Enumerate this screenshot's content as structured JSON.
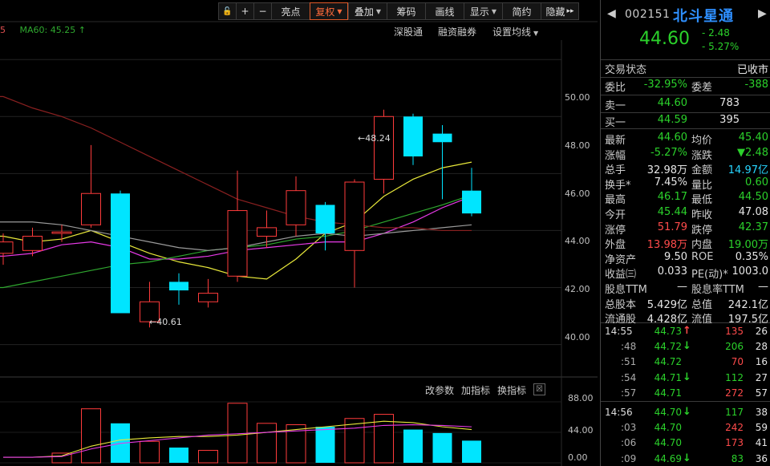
{
  "toolbar": {
    "buttons": [
      {
        "label": "🔓",
        "name": "lock-icon",
        "w": 22
      },
      {
        "label": "+",
        "name": "zoom-in-button",
        "w": 22
      },
      {
        "label": "−",
        "name": "zoom-out-button",
        "w": 22
      },
      {
        "label": "亮点",
        "name": "highlights-button",
        "w": 48
      },
      {
        "label": "复权",
        "name": "adjust-button",
        "w": 48,
        "active": true,
        "caret": true
      },
      {
        "label": "叠加",
        "name": "overlay-button",
        "w": 48,
        "caret": true
      },
      {
        "label": "筹码",
        "name": "chips-button",
        "w": 48
      },
      {
        "label": "画线",
        "name": "draw-line-button",
        "w": 48
      },
      {
        "label": "显示",
        "name": "display-button",
        "w": 48,
        "caret": true
      },
      {
        "label": "简约",
        "name": "simple-button",
        "w": 48
      },
      {
        "label": "隐藏",
        "name": "hide-button",
        "w": 48,
        "more": "▸▸"
      }
    ]
  },
  "chart": {
    "ma_label_partial": "5",
    "ma60_label": "MA60: 45.25 ↑",
    "top_links": [
      "深股通",
      "融资融券",
      "设置均线"
    ],
    "sub_links": [
      "改参数",
      "加指标",
      "换指标"
    ],
    "close_glyph": "☒",
    "high_mark": "48.24",
    "low_mark": "40.61",
    "price_axis": [
      "50.00",
      "48.00",
      "46.00",
      "44.00",
      "42.00",
      "40.00"
    ],
    "volume_axis": [
      "88.00",
      "44.00",
      "0.00"
    ]
  },
  "chart_data": {
    "type": "candlestick",
    "yaxis_ticks": [
      40,
      42,
      44,
      46,
      48,
      50
    ],
    "ylim": [
      39.2,
      50.4
    ],
    "volume_ticks": [
      0,
      44,
      88
    ],
    "volume_ylim": [
      0,
      95
    ],
    "candles": [
      {
        "o": 43.6,
        "c": 43.2,
        "h": 43.9,
        "l": 42.8,
        "up": true,
        "vol": 0
      },
      {
        "o": 43.3,
        "c": 43.8,
        "h": 44.1,
        "l": 43.1,
        "up": true,
        "vol": 0
      },
      {
        "o": 43.9,
        "c": 43.95,
        "h": 44.2,
        "l": 43.6,
        "up": true,
        "vol": 14
      },
      {
        "o": 44.2,
        "c": 45.3,
        "h": 47.0,
        "l": 44.1,
        "up": true,
        "vol": 78
      },
      {
        "o": 45.3,
        "c": 41.1,
        "h": 45.4,
        "l": 41.1,
        "up": false,
        "vol": 57
      },
      {
        "o": 41.5,
        "c": 40.8,
        "h": 42.2,
        "l": 40.6,
        "up": true,
        "vol": 31
      },
      {
        "o": 42.2,
        "c": 41.9,
        "h": 42.5,
        "l": 41.4,
        "up": false,
        "vol": 22
      },
      {
        "o": 41.8,
        "c": 41.5,
        "h": 42.3,
        "l": 41.3,
        "up": true,
        "vol": 18
      },
      {
        "o": 42.4,
        "c": 44.7,
        "h": 46.1,
        "l": 42.2,
        "up": true,
        "vol": 86
      },
      {
        "o": 44.1,
        "c": 43.8,
        "h": 44.7,
        "l": 43.4,
        "up": true,
        "vol": 57
      },
      {
        "o": 44.2,
        "c": 45.4,
        "h": 45.9,
        "l": 43.8,
        "up": true,
        "vol": 55
      },
      {
        "o": 44.9,
        "c": 43.9,
        "h": 45.0,
        "l": 43.3,
        "up": false,
        "vol": 52
      },
      {
        "o": 43.3,
        "c": 45.7,
        "h": 45.8,
        "l": 42.0,
        "up": true,
        "vol": 64
      },
      {
        "o": 45.8,
        "c": 48.0,
        "h": 48.24,
        "l": 45.3,
        "up": true,
        "vol": 70
      },
      {
        "o": 48.0,
        "c": 46.6,
        "h": 48.1,
        "l": 46.3,
        "up": false,
        "vol": 48
      },
      {
        "o": 47.4,
        "c": 47.1,
        "h": 47.7,
        "l": 45.1,
        "up": false,
        "vol": 43
      },
      {
        "o": 45.4,
        "c": 44.6,
        "h": 46.2,
        "l": 44.5,
        "up": false,
        "vol": 32
      }
    ],
    "ma_lines": [
      {
        "name": "ma-yellow",
        "color": "#e8e83a",
        "values": [
          43.8,
          43.6,
          43.7,
          44.0,
          43.6,
          43.2,
          42.9,
          42.7,
          42.4,
          42.3,
          43.0,
          43.9,
          44.3,
          45.2,
          45.8,
          46.2,
          46.4
        ]
      },
      {
        "name": "ma-magenta",
        "color": "#e83ae8",
        "values": [
          43.1,
          43.2,
          43.5,
          43.6,
          43.4,
          43.0,
          43.0,
          43.1,
          43.3,
          43.4,
          43.5,
          43.6,
          43.6,
          43.9,
          44.3,
          44.8,
          45.2
        ]
      },
      {
        "name": "ma-green",
        "color": "#2fa82f",
        "values": [
          42.0,
          42.2,
          42.4,
          42.6,
          42.8,
          42.9,
          43.1,
          43.3,
          43.4,
          43.5,
          43.7,
          43.8,
          44.0,
          44.3,
          44.6,
          44.9,
          45.25
        ]
      },
      {
        "name": "ma-gray",
        "color": "#9a9a9a",
        "values": [
          44.3,
          44.3,
          44.2,
          44.0,
          43.8,
          43.6,
          43.4,
          43.3,
          43.4,
          43.6,
          43.8,
          43.9,
          43.8,
          43.9,
          44.0,
          44.1,
          44.2
        ]
      },
      {
        "name": "ma-darkred",
        "color": "#8a2020",
        "values": [
          48.7,
          48.3,
          48.0,
          47.6,
          47.1,
          46.6,
          46.1,
          45.6,
          45.1,
          44.8,
          44.5,
          44.3,
          44.2,
          44.1,
          44.1,
          44.0,
          44.0
        ]
      }
    ],
    "vol_ma_lines": [
      {
        "name": "vol-ma-yellow",
        "color": "#e8e83a",
        "values": [
          8,
          8,
          10,
          24,
          33,
          36,
          38,
          38,
          40,
          44,
          48,
          52,
          56,
          60,
          58,
          52,
          48
        ]
      },
      {
        "name": "vol-ma-magenta",
        "color": "#e83ae8",
        "values": [
          8,
          8,
          9,
          20,
          28,
          32,
          36,
          40,
          42,
          44,
          46,
          48,
          50,
          54,
          55,
          54,
          52
        ]
      }
    ]
  },
  "quote": {
    "code": "002151",
    "name": "北斗星通",
    "price": "44.60",
    "change": "- 2.48",
    "change_pct": "- 5.27%",
    "trade_status_label": "交易状态",
    "trade_status": "已收市",
    "weibi_label": "委比",
    "weibi": "-32.95%",
    "weicha_label": "委差",
    "weicha": "-388",
    "sell1_label": "卖一",
    "sell1_price": "44.60",
    "sell1_vol": "783",
    "buy1_label": "买一",
    "buy1_price": "44.59",
    "buy1_vol": "395",
    "stats": [
      {
        "l1": "最新",
        "v1": "44.60",
        "c1": "g",
        "l2": "均价",
        "v2": "45.40",
        "c2": "g"
      },
      {
        "l1": "涨幅",
        "v1": "-5.27%",
        "c1": "g",
        "l2": "涨跌",
        "v2": "▼2.48",
        "c2": "g"
      },
      {
        "l1": "总手",
        "v1": "32.98万",
        "c1": "w",
        "l2": "金额",
        "v2": "14.97亿",
        "c2": "c"
      },
      {
        "l1": "换手*",
        "v1": "7.45%",
        "c1": "w",
        "l2": "量比",
        "v2": "0.60",
        "c2": "g"
      },
      {
        "l1": "最高",
        "v1": "46.17",
        "c1": "g",
        "l2": "最低",
        "v2": "44.50",
        "c2": "g"
      },
      {
        "l1": "今开",
        "v1": "45.44",
        "c1": "g",
        "l2": "昨收",
        "v2": "47.08",
        "c2": "w"
      },
      {
        "l1": "涨停",
        "v1": "51.79",
        "c1": "r",
        "l2": "跌停",
        "v2": "42.37",
        "c2": "g"
      },
      {
        "l1": "外盘",
        "v1": "13.98万",
        "c1": "r",
        "l2": "内盘",
        "v2": "19.00万",
        "c2": "g"
      },
      {
        "l1": "净资产",
        "v1": "9.50",
        "c1": "w",
        "l2": "ROE",
        "v2": "0.35%",
        "c2": "w"
      },
      {
        "l1": "收益㈢",
        "v1": "0.033",
        "c1": "w",
        "l2": "PE(动)*",
        "v2": "1003.0",
        "c2": "w"
      },
      {
        "l1": "股息TTM",
        "v1": "—",
        "c1": "w",
        "l2": "股息率TTM",
        "v2": "—",
        "c2": "w"
      },
      {
        "l1": "总股本",
        "v1": "5.429亿",
        "c1": "w",
        "l2": "总值",
        "v2": "242.1亿",
        "c2": "w"
      },
      {
        "l1": "流通股",
        "v1": "4.428亿",
        "c1": "w",
        "l2": "流值",
        "v2": "197.5亿",
        "c2": "w"
      }
    ],
    "ticks": [
      {
        "t": "14:55",
        "big": true,
        "p": "44.73",
        "a": "↑",
        "ac": "r",
        "v": "135",
        "vc": "r",
        "n": "26"
      },
      {
        "t": ":48",
        "big": false,
        "p": "44.72",
        "a": "↓",
        "ac": "g",
        "v": "206",
        "vc": "g",
        "n": "28"
      },
      {
        "t": ":51",
        "big": false,
        "p": "44.72",
        "a": "",
        "ac": "g",
        "v": "70",
        "vc": "r",
        "n": "16"
      },
      {
        "t": ":54",
        "big": false,
        "p": "44.71",
        "a": "↓",
        "ac": "g",
        "v": "112",
        "vc": "g",
        "n": "27"
      },
      {
        "t": ":57",
        "big": false,
        "p": "44.71",
        "a": "",
        "ac": "g",
        "v": "272",
        "vc": "r",
        "n": "57"
      },
      {
        "t": "14:56",
        "big": true,
        "p": "44.70",
        "a": "↓",
        "ac": "g",
        "v": "117",
        "vc": "g",
        "n": "38"
      },
      {
        "t": ":03",
        "big": false,
        "p": "44.70",
        "a": "",
        "ac": "g",
        "v": "242",
        "vc": "r",
        "n": "59"
      },
      {
        "t": ":06",
        "big": false,
        "p": "44.70",
        "a": "",
        "ac": "g",
        "v": "173",
        "vc": "r",
        "n": "41"
      },
      {
        "t": ":09",
        "big": false,
        "p": "44.69",
        "a": "↓",
        "ac": "g",
        "v": "83",
        "vc": "g",
        "n": "36"
      }
    ]
  }
}
